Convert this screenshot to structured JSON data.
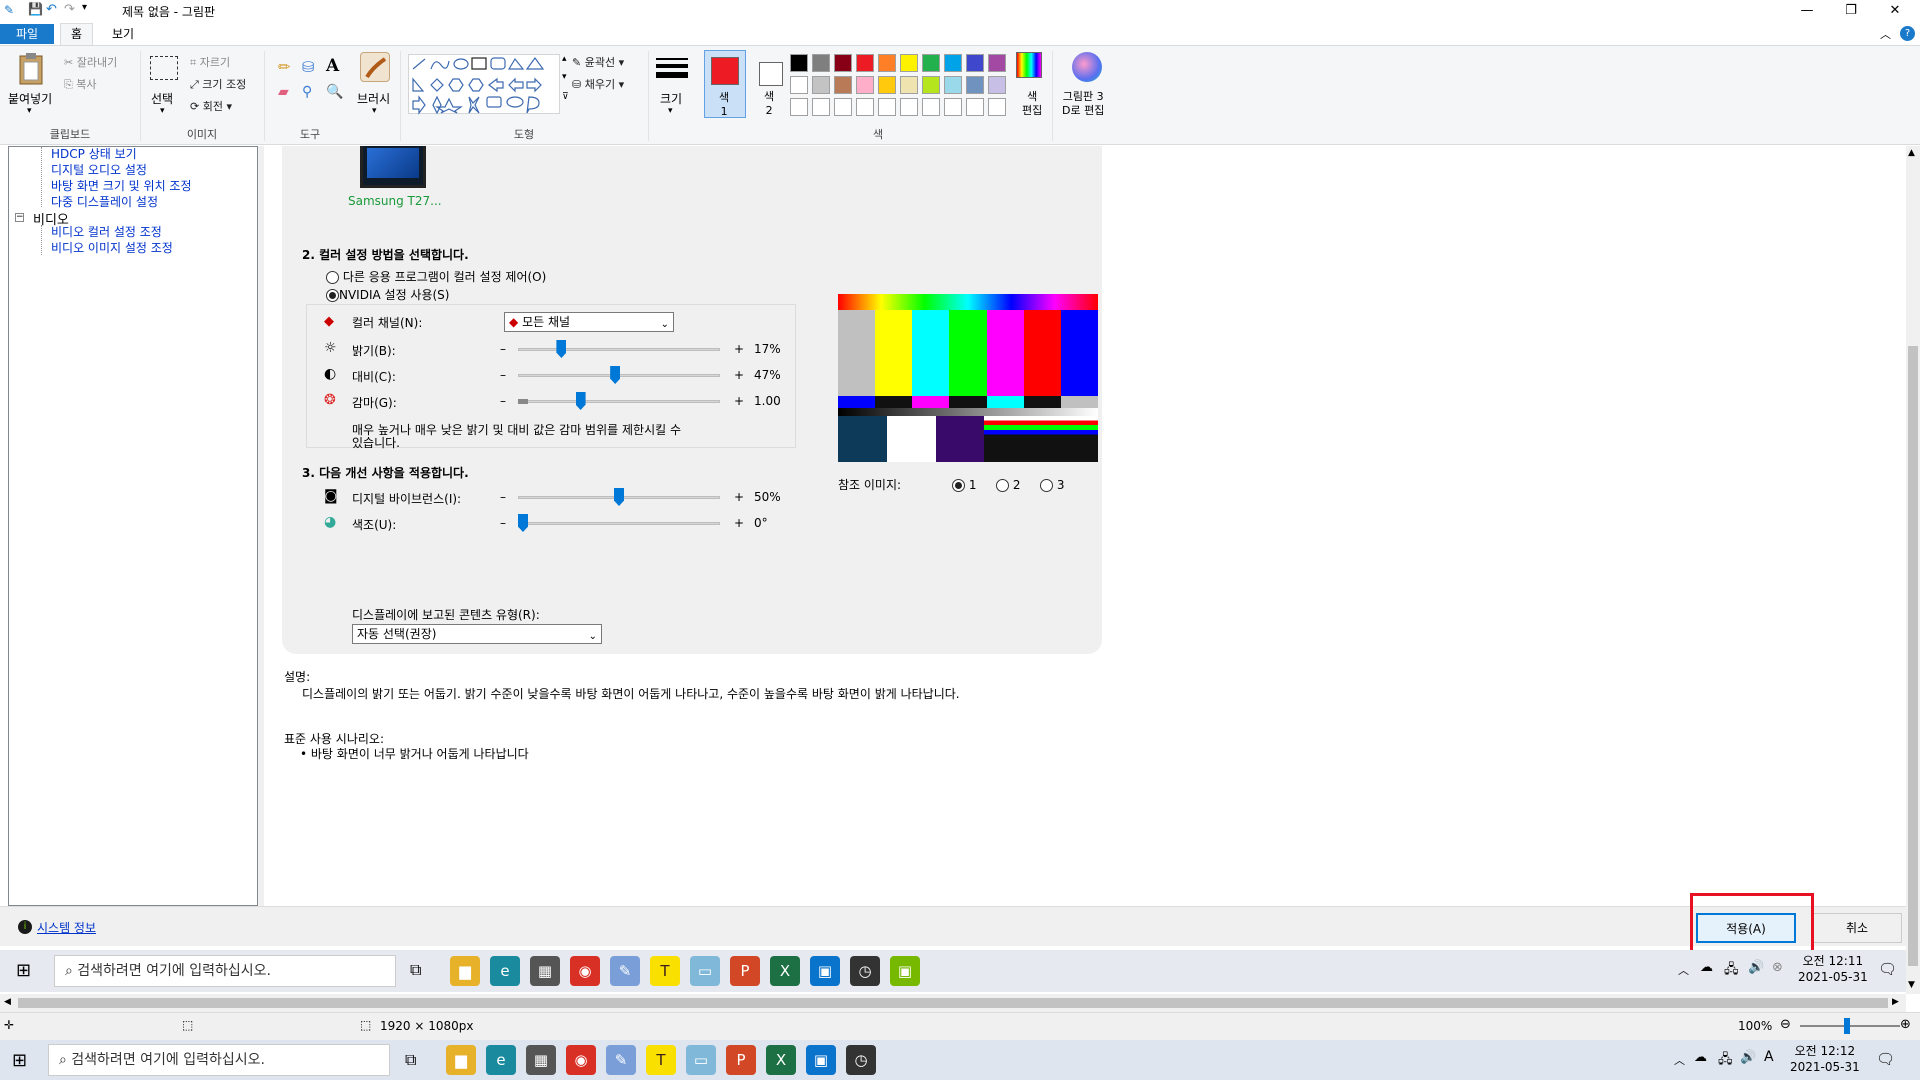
{
  "title": "제목 없음 - 그림판",
  "tabs": {
    "file": "파일",
    "home": "홈",
    "view": "보기"
  },
  "clipboard": {
    "paste": "붙여넣기",
    "cut": "잘라내기",
    "copy": "복사",
    "label": "클립보드"
  },
  "image": {
    "select": "선택",
    "crop": "자르기",
    "resize": "크기 조정",
    "rotate": "회전",
    "label": "이미지"
  },
  "tools": {
    "label": "도구",
    "brush": "브러시"
  },
  "shapes": {
    "outline": "윤곽선",
    "fill": "채우기",
    "label": "도형"
  },
  "size": {
    "label": "크기"
  },
  "colors": {
    "color1": "색\n1",
    "color1_a": "색",
    "color1_b": "1",
    "color2_a": "색",
    "color2_b": "2",
    "edit_a": "색",
    "edit_b": "편집",
    "label": "색",
    "paint3d_a": "그림판 3",
    "paint3d_b": "D로 편집",
    "palette_row1": [
      "#000000",
      "#7f7f7f",
      "#880015",
      "#ed1c24",
      "#ff7f27",
      "#fff200",
      "#22b14c",
      "#00a2e8",
      "#3f48cc",
      "#a349a4"
    ],
    "palette_row2": [
      "#ffffff",
      "#c3c3c3",
      "#b97a57",
      "#ffaec9",
      "#ffc90e",
      "#efe4b0",
      "#b5e61d",
      "#99d9ea",
      "#7092be",
      "#c8bfe7"
    ],
    "primary": "#ed1c24",
    "secondary": "#ffffff"
  },
  "tree": {
    "items": [
      "HDCP 상태 보기",
      "디지털 오디오 설정",
      "바탕 화면 크기 및 위치 조정",
      "다중 디스플레이 설정"
    ],
    "video_header": "비디오",
    "video_items": [
      "비디오 컬러 설정 조정",
      "비디오 이미지 설정 조정"
    ]
  },
  "monitor_label": "Samsung T27...",
  "section2": {
    "heading": "2. 컬러 설정 방법을 선택합니다.",
    "opt_app": "다른 응용 프로그램이 컬러 설정 제어(O)",
    "opt_nvidia": "NVIDIA 설정 사용(S)",
    "channel_label": "컬러 채널(N):",
    "channel_value": "모든 채널",
    "brightness_label": "밝기(B):",
    "brightness_value": "17%",
    "brightness_pct": 0.2,
    "contrast_label": "대비(C):",
    "contrast_value": "47%",
    "contrast_pct": 0.48,
    "gamma_label": "감마(G):",
    "gamma_value": "1.00",
    "gamma_pct": 0.3,
    "note_line1": "매우 높거나 매우 낮은 밝기 및 대비 값은 감마 범위를 제한시킬 수",
    "note_line2": "있습니다."
  },
  "section3": {
    "heading": "3. 다음 개선 사항을 적용합니다.",
    "vibrance_label": "디지털 바이브런스(I):",
    "vibrance_value": "50%",
    "vibrance_pct": 0.5,
    "hue_label": "색조(U):",
    "hue_value": "0°",
    "hue_pct": 0.0
  },
  "minus": "–",
  "plus": "+",
  "reference": {
    "label": "참조 이미지:",
    "options": [
      "1",
      "2",
      "3"
    ],
    "selected": "1"
  },
  "content_type": {
    "label": "디스플레이에 보고된 콘텐츠 유형(R):",
    "value": "자동 선택(권장)"
  },
  "description": {
    "label": "설명:",
    "text": "디스플레이의 밝기 또는 어둡기. 밝기 수준이 낮을수록 바탕 화면이 어둡게 나타나고, 수준이 높을수록 바탕 화면이 밝게 나타납니다.",
    "scenario_label": "표준 사용 시나리오:",
    "scenario_item": "• 바탕 화면이 너무 밝거나 어둡게 나타납니다"
  },
  "system_info": "시스템 정보",
  "apply": "적용(A)",
  "cancel": "취소",
  "taskbar_inner": {
    "search": "검색하려면 여기에 입력하십시오.",
    "ampm": "오전 12:11",
    "date": "2021-05-31"
  },
  "taskbar_outer": {
    "search": "검색하려면 여기에 입력하십시오.",
    "ampm": "오전 12:12",
    "date": "2021-05-31",
    "ime": "A"
  },
  "status": {
    "dimensions": "1920 × 1080px",
    "zoom": "100%"
  }
}
